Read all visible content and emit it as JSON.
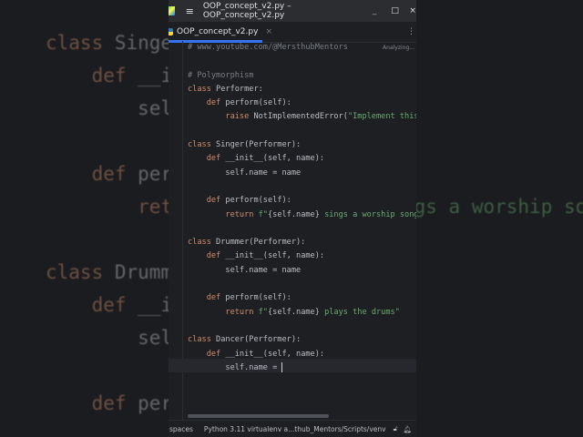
{
  "window": {
    "title": "OOP_concept_v2.py – OOP_concept_v2.py"
  },
  "tab": {
    "label": "OOP_concept_v2.py",
    "close": "×"
  },
  "editor": {
    "status": "Analyzing...",
    "lines": [
      [
        [
          "cm",
          "# www.youtube.com/@MersthubMentors"
        ]
      ],
      [],
      [
        [
          "cm",
          "# Polymorphism"
        ]
      ],
      [
        [
          "kw",
          "class "
        ],
        [
          "tx",
          "Performer:"
        ]
      ],
      [
        [
          "tx",
          "    "
        ],
        [
          "kw",
          "def "
        ],
        [
          "tx",
          "perform(self):"
        ]
      ],
      [
        [
          "tx",
          "        "
        ],
        [
          "kw",
          "raise "
        ],
        [
          "tx",
          "NotImplementedError("
        ],
        [
          "str",
          "\"Implement this method\""
        ],
        [
          "tx",
          ")"
        ]
      ],
      [],
      [
        [
          "kw",
          "class "
        ],
        [
          "tx",
          "Singer(Performer):"
        ]
      ],
      [
        [
          "tx",
          "    "
        ],
        [
          "kw",
          "def "
        ],
        [
          "tx",
          "__init__(self, name):"
        ]
      ],
      [
        [
          "tx",
          "        self.name = name"
        ]
      ],
      [],
      [
        [
          "tx",
          "    "
        ],
        [
          "kw",
          "def "
        ],
        [
          "tx",
          "perform(self):"
        ]
      ],
      [
        [
          "tx",
          "        "
        ],
        [
          "kw",
          "return "
        ],
        [
          "str",
          "f\""
        ],
        [
          "tx",
          "{self.name}"
        ],
        [
          "str",
          " sings a worship song\""
        ]
      ],
      [],
      [
        [
          "kw",
          "class "
        ],
        [
          "tx",
          "Drummer(Performer):"
        ]
      ],
      [
        [
          "tx",
          "    "
        ],
        [
          "kw",
          "def "
        ],
        [
          "tx",
          "__init__(self, name):"
        ]
      ],
      [
        [
          "tx",
          "        self.name = name"
        ]
      ],
      [],
      [
        [
          "tx",
          "    "
        ],
        [
          "kw",
          "def "
        ],
        [
          "tx",
          "perform(self):"
        ]
      ],
      [
        [
          "tx",
          "        "
        ],
        [
          "kw",
          "return "
        ],
        [
          "str",
          "f\""
        ],
        [
          "tx",
          "{self.name}"
        ],
        [
          "str",
          " plays the drums\""
        ]
      ],
      [],
      [
        [
          "kw",
          "class "
        ],
        [
          "tx",
          "Dancer(Performer):"
        ]
      ],
      [
        [
          "tx",
          "    "
        ],
        [
          "kw",
          "def "
        ],
        [
          "tx",
          "__init__(self, name):"
        ]
      ],
      [
        [
          "tx",
          "        self.name = "
        ]
      ]
    ]
  },
  "statusbar": {
    "indent": "spaces",
    "interpreter": "Python 3.11 virtualenv a...thub_Mentors/Scripts/venv"
  }
}
